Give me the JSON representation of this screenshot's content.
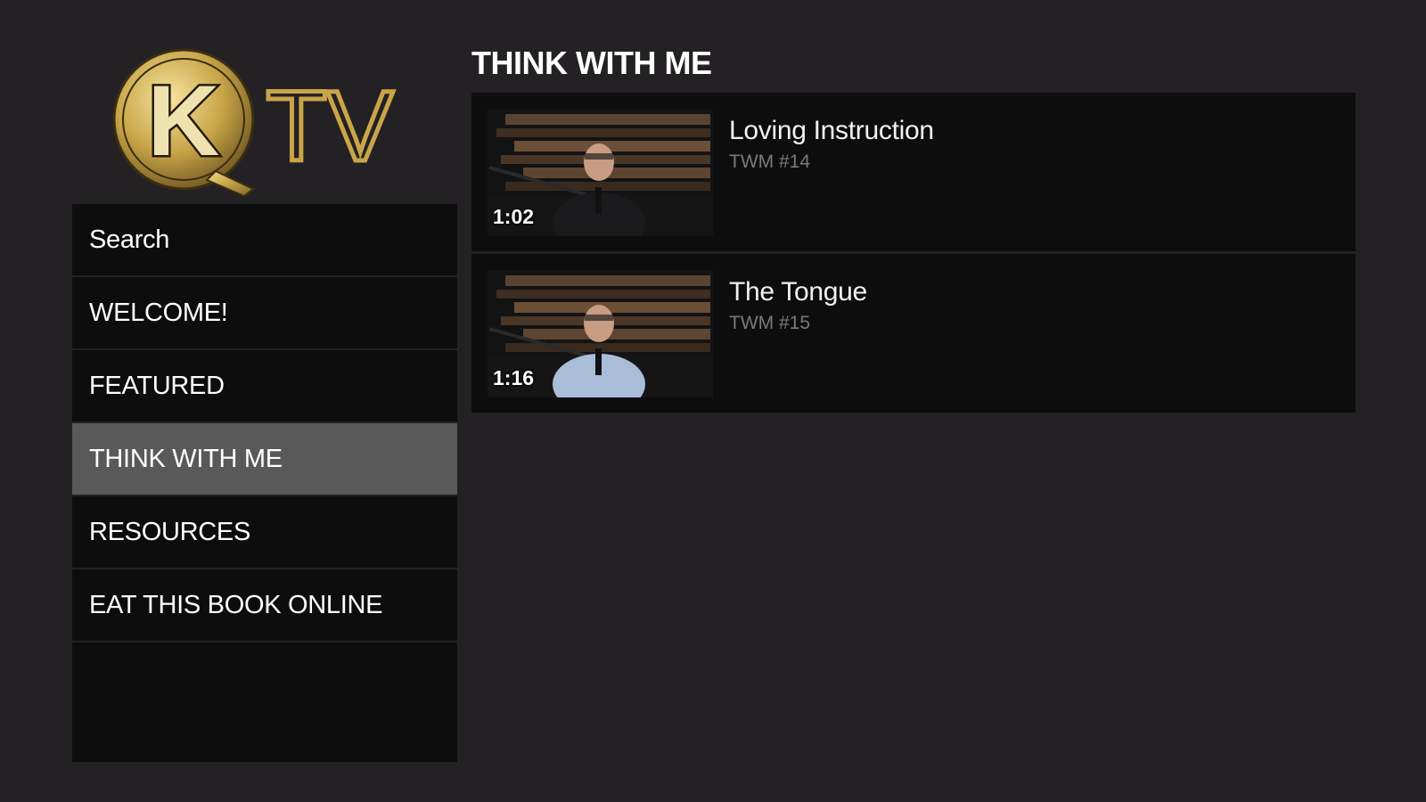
{
  "brand": {
    "logo_letter": "K",
    "logo_text": "TV",
    "accent_color": "#c8a84a"
  },
  "sidebar": {
    "items": [
      {
        "label": "Search",
        "selected": false
      },
      {
        "label": "WELCOME!",
        "selected": false
      },
      {
        "label": "FEATURED",
        "selected": false
      },
      {
        "label": "THINK WITH ME",
        "selected": true
      },
      {
        "label": "RESOURCES",
        "selected": false
      },
      {
        "label": "EAT THIS BOOK ONLINE",
        "selected": false
      }
    ]
  },
  "main": {
    "section_title": "THINK WITH ME",
    "videos": [
      {
        "title": "Loving Instruction",
        "subtitle": "TWM #14",
        "duration": "1:02",
        "shirt_color": "#1a1a1c"
      },
      {
        "title": "The Tongue",
        "subtitle": "TWM #15",
        "duration": "1:16",
        "shirt_color": "#a9bcd8"
      }
    ]
  },
  "colors": {
    "background": "#242124",
    "panel": "#0e0d0e",
    "selected": "#595959",
    "subtitle": "#7a7a7a"
  }
}
